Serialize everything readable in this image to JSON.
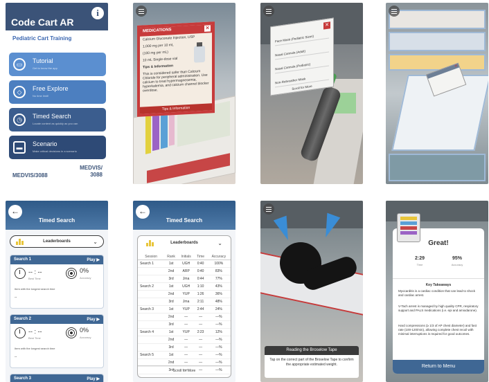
{
  "screen1": {
    "title": "Code Cart AR",
    "subtitle": "Pediatric Cart Training",
    "buttons": [
      {
        "label": "Tutorial",
        "sub": "Get to know the app",
        "icon": "book-icon",
        "color": "#5b8fd0"
      },
      {
        "label": "Free Explore",
        "sub": "No time limit!",
        "icon": "compass-icon",
        "color": "#4c7fc0"
      },
      {
        "label": "Timed Search",
        "sub": "Locate content as quickly as you can",
        "icon": "stopwatch-icon",
        "color": "#3b5d8e"
      },
      {
        "label": "Scenario",
        "sub": "Make critical decisions in a scenario",
        "icon": "scenario-icon",
        "color": "#2e4a76"
      }
    ],
    "footer_left": "MEDVIS/3088",
    "footer_right_line1": "MEDVIS/",
    "footer_right_line2": "3088"
  },
  "screen2": {
    "card_title": "MEDICATIONS",
    "drug_name": "Calcium Gluconate Injection, USP",
    "dose1": "1,000 mg per 10 mL",
    "dose2": "(100 mg per mL)",
    "volume": "10 mL Single-dose vial",
    "tips_heading": "Tips & Information",
    "tips_text": "This is considered safer than Calcium Chloride for peripheral administration. Use calcium to treat hypermagnesemia, hyperkalemia, and calcium channel blocker overdose.",
    "tab_label": "Tips & Information"
  },
  "screen3": {
    "items": [
      "Face Mask (Pediatric Sizes)",
      "Nasal Cannula (Adult)",
      "Nasal Cannula (Pediatric)",
      "Non-Rebreather Mask"
    ],
    "footer": "Scroll for More"
  },
  "screen5": {
    "title": "Timed Search",
    "dropdown": "Leaderboards",
    "cards": [
      {
        "name": "Search 1",
        "play": "Play ▶",
        "best_time": "-- : --",
        "best_label": "Best Time",
        "accuracy": "0%",
        "accuracy_label": "Accuracy",
        "longest_label": "Item with the longest search time",
        "longest_value": "--"
      },
      {
        "name": "Search 2",
        "play": "Play ▶",
        "best_time": "-- : --",
        "best_label": "Best Time",
        "accuracy": "0%",
        "accuracy_label": "Accuracy",
        "longest_label": "Item with the longest search time",
        "longest_value": "--"
      }
    ],
    "next_card": "Search 3",
    "next_play": "Play ▶"
  },
  "screen6": {
    "title": "Timed Search",
    "dropdown": "Leaderboards",
    "columns": [
      "Session",
      "Rank",
      "Initials",
      "Time",
      "Accuracy"
    ],
    "rows": [
      [
        "Search 1",
        "1st",
        "UGH",
        "0:40",
        "100%"
      ],
      [
        "",
        "2nd",
        "ARP",
        "0:40",
        "83%"
      ],
      [
        "",
        "3rd",
        "Jma",
        "0:44",
        "77%"
      ],
      [
        "Search 2",
        "1st",
        "UGH",
        "1:10",
        "43%"
      ],
      [
        "",
        "2nd",
        "YUP",
        "1:26",
        "36%"
      ],
      [
        "",
        "3rd",
        "Jma",
        "2:11",
        "48%"
      ],
      [
        "Search 3",
        "1st",
        "YUP",
        "2:44",
        "24%"
      ],
      [
        "",
        "2nd",
        "—",
        "—",
        "—%"
      ],
      [
        "",
        "3rd",
        "—",
        "—",
        "—%"
      ],
      [
        "Search 4",
        "1st",
        "YUP",
        "2:23",
        "12%"
      ],
      [
        "",
        "2nd",
        "—",
        "—",
        "—%"
      ],
      [
        "",
        "3rd",
        "—",
        "—",
        "—%"
      ],
      [
        "Search 5",
        "1st",
        "—",
        "—",
        "—%"
      ],
      [
        "",
        "2nd",
        "—",
        "—",
        "—%"
      ],
      [
        "",
        "3rd",
        "—",
        "—",
        "—%"
      ]
    ],
    "scroll": "Scroll for More"
  },
  "screen7": {
    "heading": "Reading the Broselow Tape",
    "text": "Tap on the correct part of the Broselow Tape to confirm the appropriate estimated weight."
  },
  "screen8": {
    "title": "Great!",
    "time": "2:29",
    "time_label": "Time",
    "accuracy": "95%",
    "accuracy_label": "Accuracy",
    "takeaways_heading": "Key Takeaways",
    "points": [
      "Myocarditis is a cardiac condition that can lead to shock and cardiac arrest.",
      "V-Tach arrest is managed by high quality CPR, respiratory support and PALS medications (i.e. epi and amiodarone).",
      "Hard compressions (≥ 1/3 of AP chest diameter) and fast rate (100-120/min), allowing complete chest recoil with minimal interruptions is required for good outcomes."
    ],
    "button": "Return to Menu"
  }
}
